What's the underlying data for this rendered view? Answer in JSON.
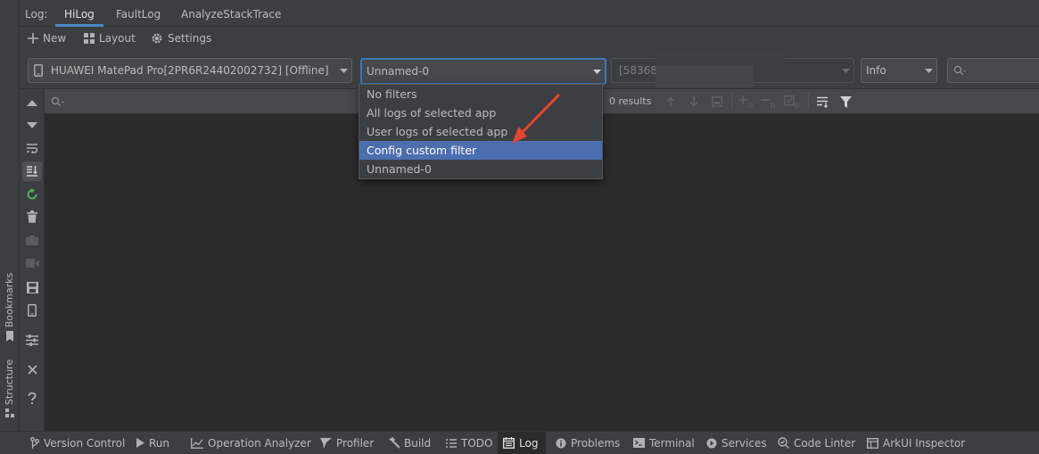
{
  "side_strip": {
    "bookmarks": "Bookmarks",
    "structure": "Structure"
  },
  "log_window": {
    "prefix": "Log:",
    "tabs": [
      "HiLog",
      "FaultLog",
      "AnalyzeStackTrace"
    ],
    "active_tab": "HiLog"
  },
  "actions": {
    "new": "New",
    "layout": "Layout",
    "settings": "Settings"
  },
  "filters": {
    "device": "HUAWEI MatePad Pro[2PR6R24402002732] [Offline]",
    "filter": "Unnamed-0",
    "process": "[58368]",
    "level": "Info",
    "search_placeholder": ""
  },
  "results": {
    "count_text": "0 results"
  },
  "dropdown": {
    "items": [
      "No filters",
      "All logs of selected app",
      "User logs of selected app",
      "Config custom filter",
      "Unnamed-0"
    ],
    "highlighted": "Config custom filter"
  },
  "bottom_bar": {
    "items": [
      "Version Control",
      "Run",
      "Operation Analyzer",
      "Profiler",
      "Build",
      "TODO",
      "Log",
      "Problems",
      "Terminal",
      "Services",
      "Code Linter",
      "ArkUI Inspector"
    ],
    "active": "Log"
  },
  "colors": {
    "accent": "#4a88c7",
    "selection": "#4b6eaf",
    "annotation_arrow": "#e8452f",
    "refresh_icon": "#59a869"
  }
}
